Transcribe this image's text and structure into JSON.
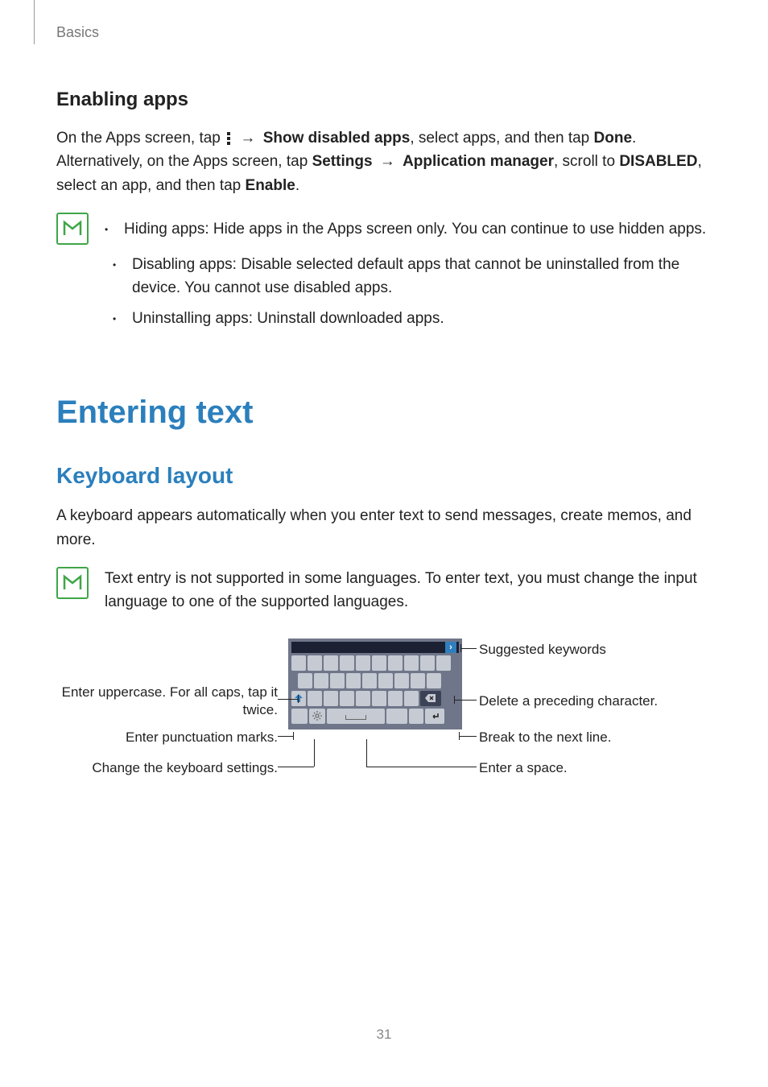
{
  "header": {
    "breadcrumb": "Basics"
  },
  "section1": {
    "heading": "Enabling apps",
    "p1_a": "On the Apps screen, tap ",
    "p1_b": " → ",
    "p1_bold1": "Show disabled apps",
    "p1_c": ", select apps, and then tap ",
    "p1_bold2": "Done",
    "p1_d": ".",
    "p2_a": "Alternatively, on the Apps screen, tap ",
    "p2_bold1": "Settings",
    "p2_b": " → ",
    "p2_bold2": "Application manager",
    "p2_c": ", scroll to ",
    "p2_bold3": "DISABLED",
    "p2_d": ", select an app, and then tap ",
    "p2_bold4": "Enable",
    "p2_e": ".",
    "bullets": [
      "Hiding apps: Hide apps in the Apps screen only. You can continue to use hidden apps.",
      "Disabling apps: Disable selected default apps that cannot be uninstalled from the device. You cannot use disabled apps.",
      "Uninstalling apps: Uninstall downloaded apps."
    ]
  },
  "section2": {
    "h1": "Entering text",
    "h2": "Keyboard layout",
    "intro": "A keyboard appears automatically when you enter text to send messages, create memos, and more.",
    "note": "Text entry is not supported in some languages. To enter text, you must change the input language to one of the supported languages."
  },
  "callouts": {
    "left1": "Enter uppercase. For all caps, tap it twice.",
    "left2": "Enter punctuation marks.",
    "left3": "Change the keyboard settings.",
    "right1": "Suggested keywords",
    "right2": "Delete a preceding character.",
    "right3": "Break to the next line.",
    "right4": "Enter a space."
  },
  "page_number": "31"
}
